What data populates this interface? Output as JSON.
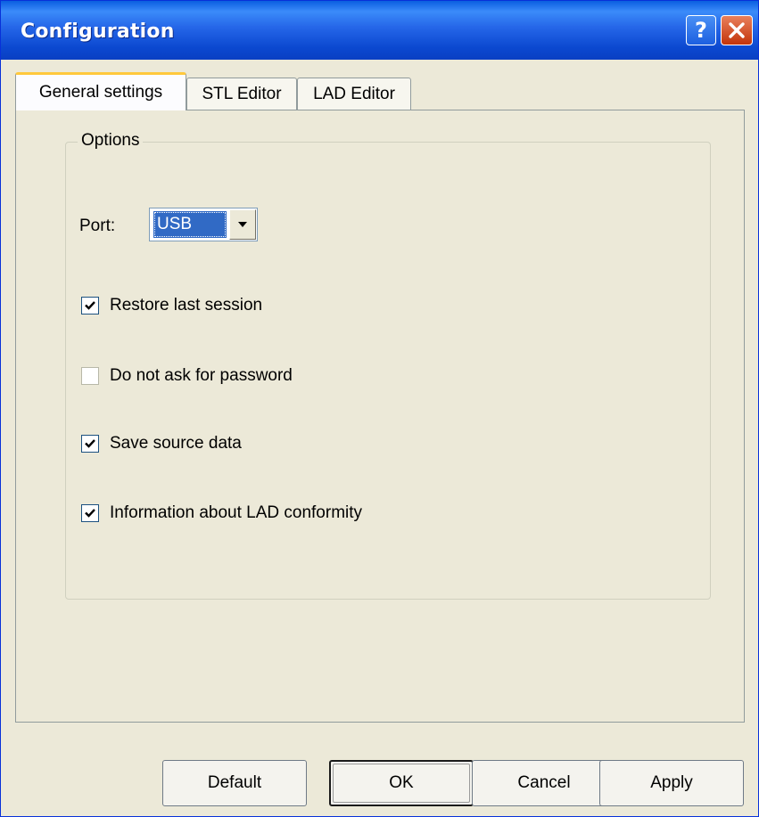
{
  "window": {
    "title": "Configuration"
  },
  "titlebar": {
    "help_label": "?"
  },
  "tabs": [
    {
      "label": "General settings",
      "active": true
    },
    {
      "label": "STL Editor",
      "active": false
    },
    {
      "label": "LAD Editor",
      "active": false
    }
  ],
  "options": {
    "group_label": "Options",
    "port": {
      "label": "Port:",
      "value": "USB"
    },
    "checkboxes": [
      {
        "label": "Restore last session",
        "checked": true
      },
      {
        "label": "Do not ask for password",
        "checked": false
      },
      {
        "label": "Save source data",
        "checked": true
      },
      {
        "label": "Information about LAD conformity",
        "checked": true
      }
    ]
  },
  "buttons": {
    "default": "Default",
    "ok": "OK",
    "cancel": "Cancel",
    "apply": "Apply"
  },
  "colors": {
    "titlebar": "#0a48d0",
    "selection": "#316ac5",
    "dialog_bg": "#ece9d8"
  }
}
